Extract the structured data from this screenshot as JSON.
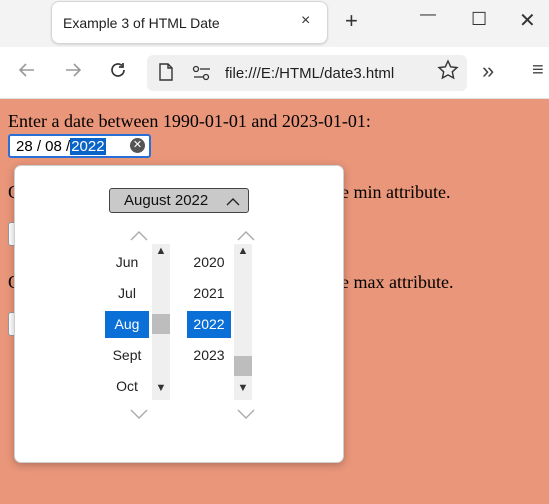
{
  "browser": {
    "tab_title": "Example 3 of HTML Date",
    "tab_close": "×",
    "new_tab": "+",
    "minimize": "—",
    "maximize": "☐",
    "url": "file:///E:/HTML/date3.html",
    "overflow": "»",
    "menu": "≡"
  },
  "page": {
    "intro": "Enter a date between 1990-01-01 and 2023-01-01:",
    "date_value_day_month": "28 / 08 /",
    "date_value_year": "2022",
    "line2_left": "O",
    "line2_right": "e min attribute.",
    "line3_left": "O",
    "line3_right": "e max attribute."
  },
  "datepicker": {
    "month_year": "August 2022",
    "months": [
      "Jun",
      "Jul",
      "Aug",
      "Sept",
      "Oct"
    ],
    "selected_month": "Aug",
    "years": [
      "2020",
      "2021",
      "2022",
      "2023"
    ],
    "selected_year": "2022"
  },
  "icons": {
    "back": "arrow-left-icon",
    "forward": "arrow-right-icon",
    "reload": "reload-icon",
    "page": "page-icon",
    "site_info": "site-info-icon",
    "favorite": "star-icon",
    "clear": "clear-icon"
  },
  "colors": {
    "page_background": "#e9967a",
    "accent": "#0a6fd6"
  }
}
